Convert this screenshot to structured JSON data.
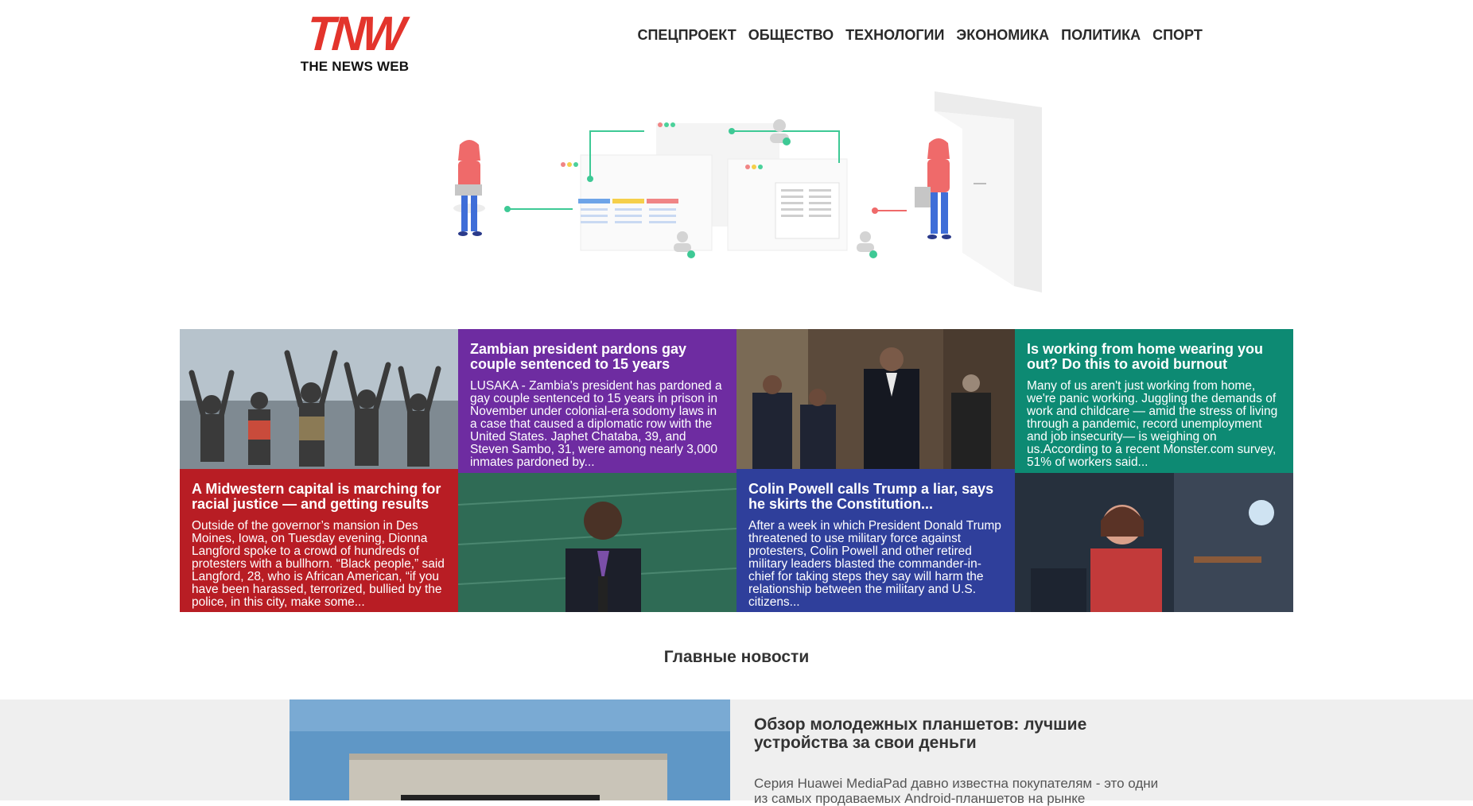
{
  "site": {
    "logo_mark": "TNW",
    "logo_sub": "THE NEWS WEB",
    "brand_color": "#e3342c"
  },
  "nav": {
    "items": [
      {
        "label": "СПЕЦПРОЕКТ"
      },
      {
        "label": "ОБЩЕСТВО"
      },
      {
        "label": "ТЕХНОЛОГИИ"
      },
      {
        "label": "ЭКОНОМИКА"
      },
      {
        "label": "ПОЛИТИКА"
      },
      {
        "label": "СПОРТ"
      }
    ]
  },
  "news": [
    {
      "title": "Zambian president pardons gay couple sentenced to 15 years",
      "excerpt": "LUSAKA - Zambia's president has pardoned a gay couple sentenced to 15 years in prison in November under colonial-era sodomy laws in a case that caused a diplomatic row with the United States. Japhet Chataba, 39, and Steven Sambo, 31, were among nearly 3,000 inmates pardoned by...",
      "color": "#6e2ca1"
    },
    {
      "title": "Is working from home wearing you out? Do this to avoid burnout",
      "excerpt": "Many of us aren't just working from home, we're panic working. Juggling the demands of work and childcare — amid the stress of living through a pandemic, record unemployment and job insecurity— is weighing on us.According to a recent Monster.com survey, 51% of workers said...",
      "color": "#0d8a73"
    },
    {
      "title": "A Midwestern capital is marching for racial justice — and getting results",
      "excerpt": "Outside of the governor’s mansion in Des Moines, Iowa, on Tuesday evening, Dionna Langford spoke to a crowd of hundreds of protesters with a bullhorn. “Black people,” said Langford, 28, who is African American, “if you have been harassed, terrorized, bullied by the police, in this city, make some...",
      "color": "#b81d24"
    },
    {
      "title": "Colin Powell calls Trump a liar, says he skirts the Constitution...",
      "excerpt": "After a week in which President Donald Trump threatened to use military force against protesters, Colin Powell and other retired military leaders blasted the commander-in-chief for taking steps they say will harm the relationship between the military and U.S. citizens...",
      "color": "#2f3f9b"
    }
  ],
  "main_news": {
    "heading": "Главные новости",
    "featured_title": "Обзор молодежных планшетов: лучшие устройства за свои деньги",
    "featured_text": "Серия Huawei MediaPad давно известна покупателям - это одни из самых продаваемых Android-планшетов на рынке"
  }
}
